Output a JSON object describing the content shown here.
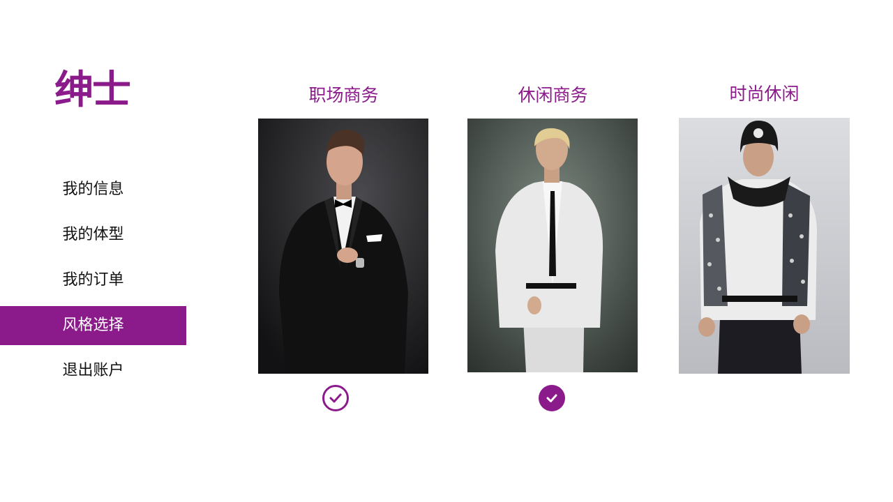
{
  "brand": {
    "logo_text": "绅士",
    "accent": "#8b1a8b"
  },
  "menu": {
    "items": [
      {
        "label": "我的信息",
        "active": false
      },
      {
        "label": "我的体型",
        "active": false
      },
      {
        "label": "我的订单",
        "active": false
      },
      {
        "label": "风格选择",
        "active": true
      },
      {
        "label": "退出账户",
        "active": false
      }
    ]
  },
  "styles": [
    {
      "title": "职场商务",
      "selection_state": "outline-check",
      "photo_icon": "man-black-tuxedo"
    },
    {
      "title": "休闲商务",
      "selection_state": "filled-check",
      "photo_icon": "man-white-suit"
    },
    {
      "title": "时尚休闲",
      "selection_state": "none",
      "photo_icon": "man-beanie-scarf"
    }
  ]
}
